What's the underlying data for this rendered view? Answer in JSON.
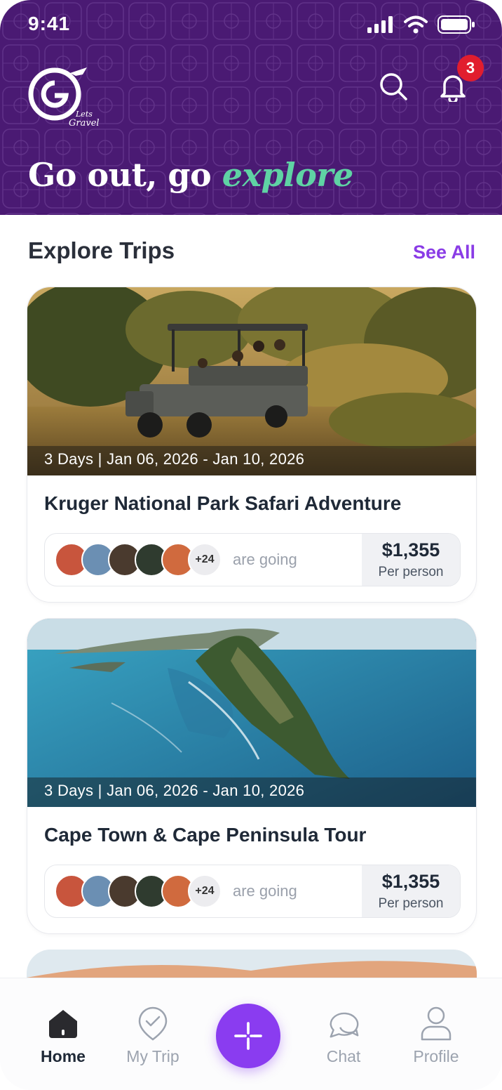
{
  "status_bar": {
    "time": "9:41"
  },
  "header": {
    "logo_alt": "Lets Gravel",
    "tagline_main": "Go out, go ",
    "tagline_accent": "explore",
    "notification_count": "3"
  },
  "section": {
    "title": "Explore Trips",
    "see_all": "See All"
  },
  "trips": [
    {
      "dates": "3 Days | Jan 06, 2026 - Jan 10, 2026",
      "title": "Kruger National Park Safari Adventure",
      "more_count": "+24",
      "going_label": "are going",
      "price": "$1,355",
      "price_unit": "Per person"
    },
    {
      "dates": "3 Days | Jan 06, 2026 - Jan 10, 2026",
      "title": "Cape Town & Cape Peninsula Tour",
      "more_count": "+24",
      "going_label": "are going",
      "price": "$1,355",
      "price_unit": "Per person"
    }
  ],
  "bottom_nav": {
    "items": [
      {
        "label": "Home",
        "icon": "home-icon",
        "active": true
      },
      {
        "label": "My Trip",
        "icon": "check-shield-icon",
        "active": false
      },
      {
        "label": "Chat",
        "icon": "chat-icon",
        "active": false
      },
      {
        "label": "Profile",
        "icon": "profile-icon",
        "active": false
      }
    ],
    "fab_icon": "plus-icon"
  },
  "colors": {
    "header_bg": "#4a1a73",
    "accent_green": "#5fd3a4",
    "brand_purple": "#8a3cf0",
    "badge_red": "#e11d2e"
  }
}
